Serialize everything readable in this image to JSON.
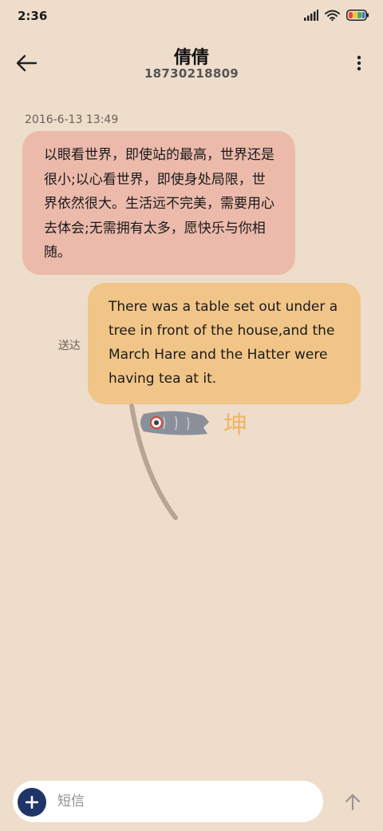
{
  "status_bar": {
    "time": "2:36"
  },
  "header": {
    "contact_name": "倩倩",
    "contact_number": "18730218809"
  },
  "conversation": {
    "timestamp": "2016-6-13 13:49",
    "incoming_message": "以眼看世界，即使站的最高，世界还是很小;以心看世界，即使身处局限，世界依然很大。生活远不完美，需要用心去体会;无需拥有太多，愿快乐与你相随。",
    "outgoing_message": "There was a table set out under a tree in front of the house,and the March Hare and the Hatter were having tea at it.",
    "delivery_status": "送达"
  },
  "composer": {
    "placeholder": "短信",
    "value": ""
  },
  "colors": {
    "background": "#eeddcb",
    "incoming_bubble": "#ecbaab",
    "outgoing_bubble": "#f1c587",
    "add_button": "#1f3567"
  },
  "icons": {
    "back": "back-arrow-icon",
    "more": "more-vertical-icon",
    "add": "plus-icon",
    "send": "send-arrow-icon",
    "signal": "signal-icon",
    "wifi": "wifi-icon",
    "battery": "battery-icon"
  }
}
